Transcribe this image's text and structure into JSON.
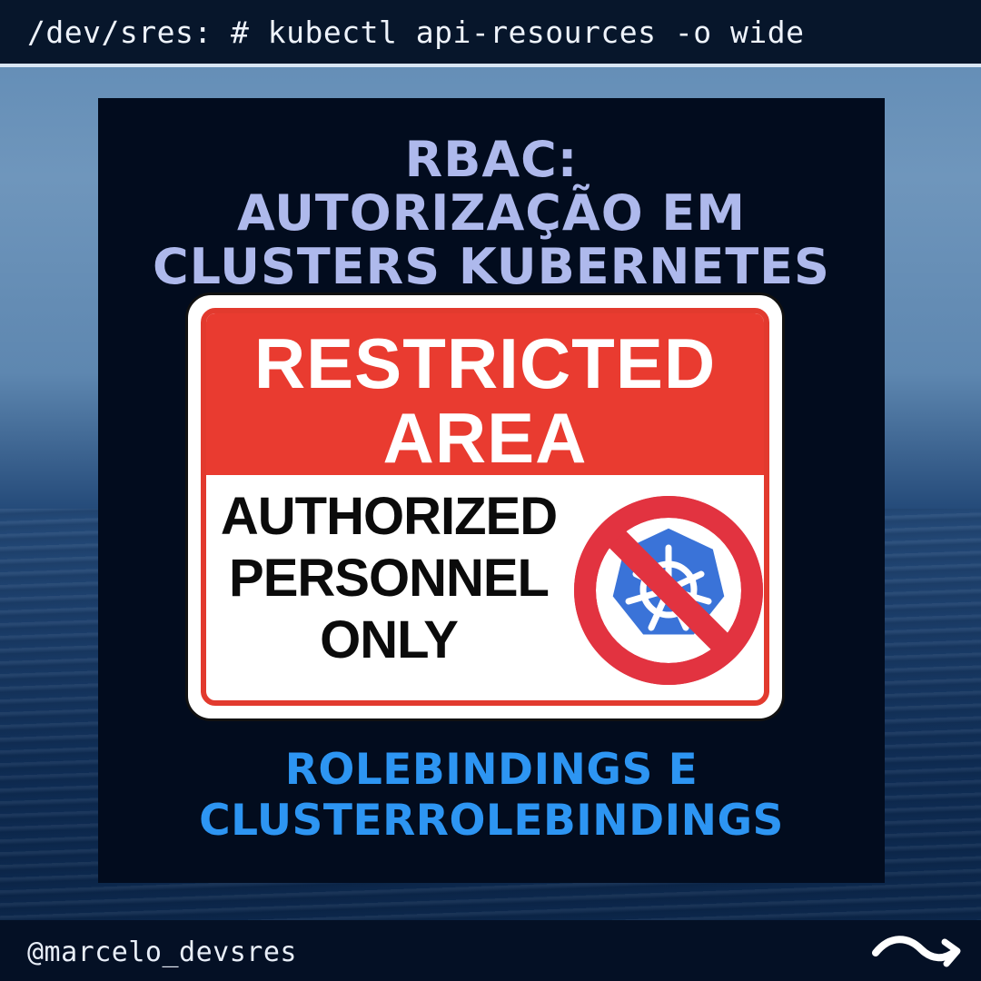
{
  "header": {
    "command": "/dev/sres: # kubectl api-resources -o wide"
  },
  "title": {
    "line1": "RBAC:",
    "line2": "AUTORIZAÇÃO EM",
    "line3": "CLUSTERS KUBERNETES"
  },
  "sign": {
    "heading_line1": "RESTRICTED",
    "heading_line2": "AREA",
    "body_line1": "AUTHORIZED",
    "body_line2": "PERSONNEL",
    "body_line3": "ONLY",
    "icon": "kubernetes-helm-prohibited-icon"
  },
  "subtitle": {
    "line1": "ROLEBINDINGS E",
    "line2": "CLUSTERROLEBINDINGS"
  },
  "footer": {
    "handle": "@marcelo_devsres",
    "next_icon": "swipe-arrow-icon"
  },
  "colors": {
    "title": "#aeb9ec",
    "subtitle": "#2d95f2",
    "sign_red": "#e93b30",
    "panel": "#020c1e",
    "kubernetes_blue": "#3a73d8"
  }
}
